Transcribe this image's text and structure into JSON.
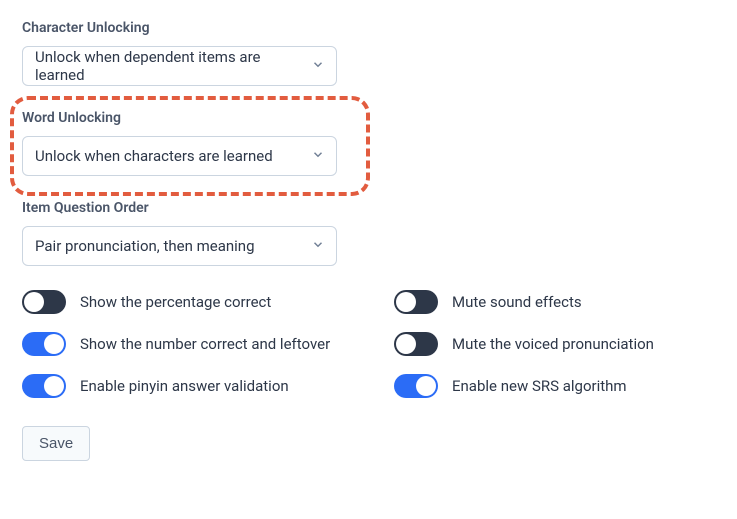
{
  "fields": {
    "character_unlocking": {
      "label": "Character Unlocking",
      "value": "Unlock when dependent items are learned"
    },
    "word_unlocking": {
      "label": "Word Unlocking",
      "value": "Unlock when characters are learned"
    },
    "item_question_order": {
      "label": "Item Question Order",
      "value": "Pair pronunciation, then meaning"
    }
  },
  "toggles": {
    "left": [
      {
        "label": "Show the percentage correct",
        "on": false
      },
      {
        "label": "Show the number correct and leftover",
        "on": true
      },
      {
        "label": "Enable pinyin answer validation",
        "on": true
      }
    ],
    "right": [
      {
        "label": "Mute sound effects",
        "on": false
      },
      {
        "label": "Mute the voiced pronunciation",
        "on": false
      },
      {
        "label": "Enable new SRS algorithm",
        "on": true
      }
    ]
  },
  "buttons": {
    "save": "Save"
  },
  "colors": {
    "highlight": "#e25c3f",
    "toggle_on": "#2b6cf6",
    "toggle_off": "#2d3748"
  }
}
